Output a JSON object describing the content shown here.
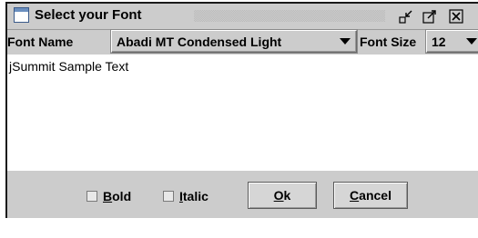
{
  "window": {
    "title": "Select your Font"
  },
  "font_name": {
    "label": "Font Name",
    "selected": "Abadi MT Condensed Light"
  },
  "font_size": {
    "label": "Font Size",
    "selected": "12"
  },
  "sample": {
    "text": "jSummit Sample Text"
  },
  "options": {
    "bold": {
      "mnemonic": "B",
      "rest": "old",
      "checked": false
    },
    "italic": {
      "mnemonic": "I",
      "rest": "talic",
      "checked": false
    }
  },
  "buttons": {
    "ok": {
      "mnemonic": "O",
      "rest": "k"
    },
    "cancel": {
      "mnemonic": "C",
      "rest": "ancel"
    }
  },
  "icons": {
    "window": "window-icon",
    "iconify": "iconify-icon",
    "maximize": "maximize-icon",
    "close": "close-icon",
    "dropdown": "chevron-down-icon"
  }
}
